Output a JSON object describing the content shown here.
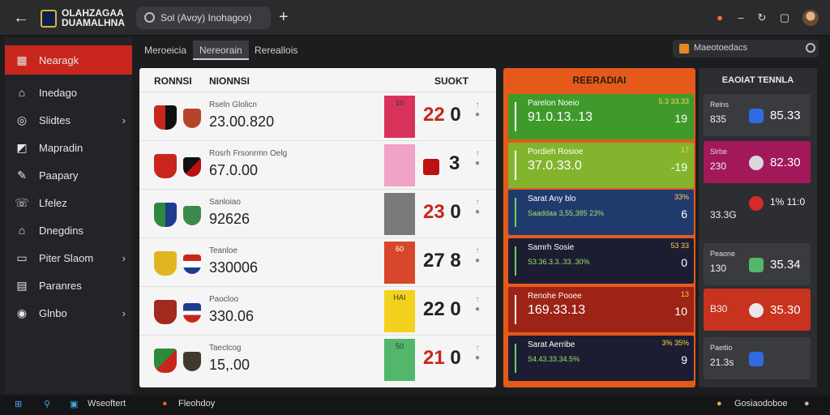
{
  "titlebar": {
    "app_name": "OLAHZAGAA DUAMALHNA",
    "tab_title": "Sol (Avoy) Inohagoo)",
    "new_tab": "+",
    "back": "←"
  },
  "sidebar": {
    "items": [
      {
        "label": "Nearagk",
        "icon": "▦",
        "active": true
      },
      {
        "label": "Inedago",
        "icon": "⌂"
      },
      {
        "label": "Slidtes",
        "icon": "◎",
        "chevron": true
      },
      {
        "label": "Mapradin",
        "icon": "◩"
      },
      {
        "label": "Paapary",
        "icon": "✎"
      },
      {
        "label": "Lfelez",
        "icon": "☏"
      },
      {
        "label": "Dnegdins",
        "icon": "⌂"
      },
      {
        "label": "Piter Slaom",
        "icon": "▭",
        "chevron": true
      },
      {
        "label": "Paranres",
        "icon": "▤"
      },
      {
        "label": "Glnbo",
        "icon": "◉",
        "chevron": true
      }
    ]
  },
  "subtabs": [
    "Meroeicia",
    "Nereorain",
    "Rereallois"
  ],
  "search": {
    "text": "Maeotoedacs"
  },
  "scores": {
    "headers": {
      "col1": "RONNSI",
      "col2": "NIONNSI",
      "col3": "SUOKT"
    },
    "rows": [
      {
        "label": "Rseln Glolicn",
        "value": "23.00.820",
        "color_label": "10",
        "score_a": "22",
        "score_b": "0",
        "color": "#d8325a"
      },
      {
        "label": "Rosrh Frsonrmn Oelg",
        "value": "67.0.00",
        "color_label": "",
        "score_a": "",
        "score_b": "3",
        "color": "#f0a3c4"
      },
      {
        "label": "Sanloiao",
        "value": "92626",
        "color_label": "",
        "score_a": "23",
        "score_b": "0",
        "color": "#7a7a7a"
      },
      {
        "label": "Teanloe",
        "value": "330006",
        "color_label": "60",
        "score_a": "27",
        "score_b": "8",
        "color": "#d8462b"
      },
      {
        "label": "Paocloo",
        "value": "330.06",
        "color_label": "HAI",
        "score_a": "22",
        "score_b": "0",
        "color": "#f3d21f"
      },
      {
        "label": "Taeclcog",
        "value": "15,.00",
        "color_label": "50",
        "score_a": "21",
        "score_b": "0",
        "color": "#52b76a"
      }
    ]
  },
  "middle": {
    "title": "REERADIAI",
    "cards": [
      {
        "line1": "Parelon Noeio",
        "line2": "91.0.13..13",
        "line3": "",
        "corner": "5.3 33.33",
        "right": "19",
        "color": "#3f9a2c"
      },
      {
        "line1": "Pordieh Rosioe",
        "line2": "37.0.33.0",
        "line3": "",
        "corner": "17",
        "right": "-19",
        "color": "#82b52d"
      },
      {
        "line1": "Sarat Any blo",
        "line2": "",
        "line3": "Saaddaa 3,55,385 23%",
        "corner": "33%",
        "right": "6",
        "color": "#213a6d"
      },
      {
        "line1": "Samrh Sosie",
        "line2": "",
        "line3": "S3.36.3.3..33..30%",
        "corner": "53 33",
        "right": "0",
        "color": "#1c1d33"
      },
      {
        "line1": "Renohe Pooee",
        "line2": "169.33.13",
        "line3": "",
        "corner": "13",
        "right": "10",
        "color": "#9c2316"
      },
      {
        "line1": "Sarat Aerribe",
        "line2": "",
        "line3": "S4.43.33.34.5%",
        "corner": "3% 35%",
        "right": "9",
        "color": "#1c1d33"
      }
    ]
  },
  "right": {
    "title": "EAOIAT TENNLA",
    "cards": [
      {
        "label": "Relns",
        "num": "835",
        "value": "85.33",
        "color": "#3a3b3e",
        "badge": "#2e6be0"
      },
      {
        "label": "Slrbe",
        "num": "230",
        "value": "82.30",
        "color": "#a3185b",
        "badge": "#d9d9d9"
      },
      {
        "label": "",
        "num": "33.3G",
        "value": "1% 11:0",
        "color": "#2d2e31",
        "badge": "#d42a2a"
      },
      {
        "label": "Peaone",
        "num": "130",
        "value": "35.34",
        "color": "#3a3b3e",
        "badge": "#52b76a"
      },
      {
        "label": "",
        "num": "B30",
        "value": "35.30",
        "color": "#c8331e",
        "badge": "#e8e8e8"
      },
      {
        "label": "Paetlio",
        "num": "21.3s",
        "value": "",
        "color": "#3a3b3e",
        "badge": "#2e6be0"
      }
    ]
  },
  "taskbar": {
    "app1": "Wseoftert",
    "app2": "Fleohdoy",
    "right": "Gosiaodoboe"
  },
  "colors": {
    "accent": "#c8261c",
    "mid_panel": "#e55a1a",
    "bg": "#1c1d1f"
  }
}
